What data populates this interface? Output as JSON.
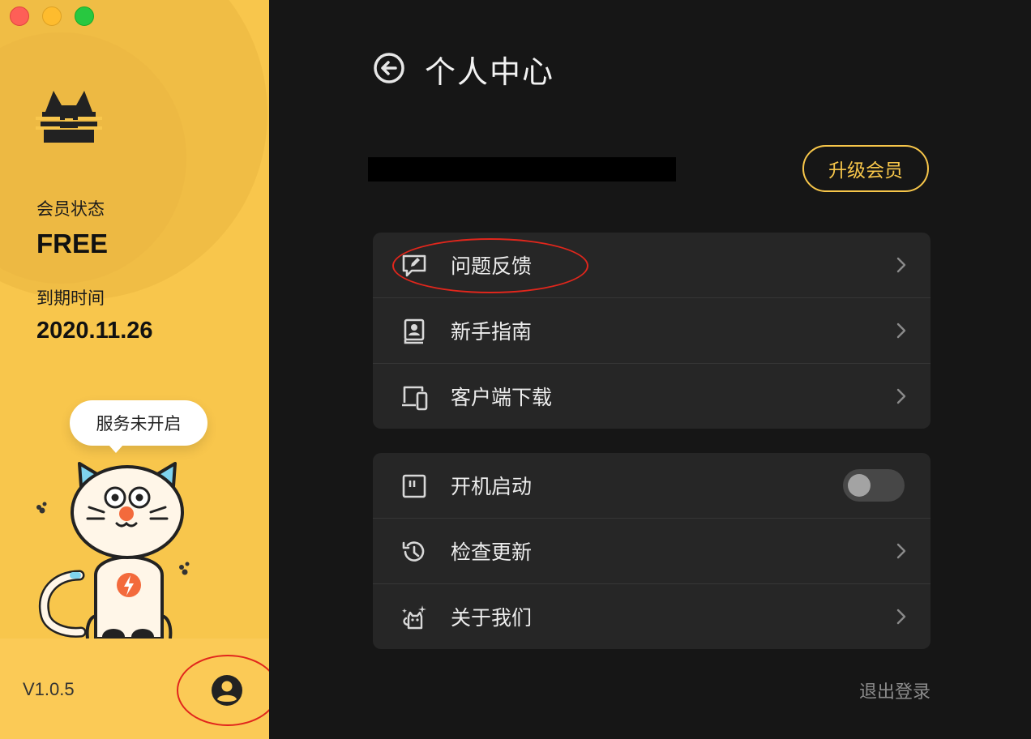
{
  "sidebar": {
    "membership_label": "会员状态",
    "membership_value": "FREE",
    "expiry_label": "到期时间",
    "expiry_value": "2020.11.26",
    "service_bubble": "服务未开启",
    "version": "V1.0.5"
  },
  "main": {
    "title": "个人中心",
    "upgrade_label": "升级会员",
    "logout_label": "退出登录",
    "menu_group_1": [
      {
        "label": "问题反馈",
        "icon": "feedback-icon"
      },
      {
        "label": "新手指南",
        "icon": "guide-book-icon"
      },
      {
        "label": "客户端下载",
        "icon": "devices-icon"
      }
    ],
    "menu_group_2": [
      {
        "label": "开机启动",
        "icon": "startup-icon",
        "toggle": false
      },
      {
        "label": "检查更新",
        "icon": "history-icon"
      },
      {
        "label": "关于我们",
        "icon": "cat-sparkle-icon"
      }
    ]
  },
  "colors": {
    "sidebar_bg": "#f8c64c",
    "main_bg": "#161616",
    "card_bg": "#262626",
    "accent": "#f7c64a",
    "annotation": "#e1261c"
  }
}
